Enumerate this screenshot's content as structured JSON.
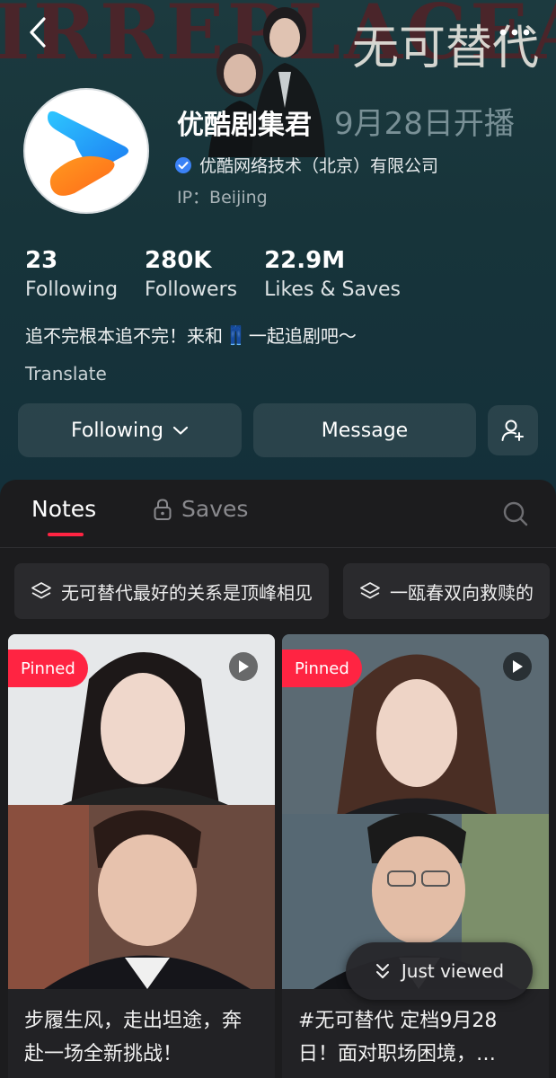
{
  "banner": {
    "watermark": "IRREPLACEABLE",
    "show_title": "无可替代",
    "premiere": "9月28日开播"
  },
  "nav": {
    "back_icon": "chevron-left-icon",
    "more_icon": "more-dots-icon"
  },
  "profile": {
    "name": "优酷剧集君",
    "verified_org": "优酷网络技术（北京）有限公司",
    "ip": "IP：Beijing",
    "bio_before": "追不完根本追不完！来和",
    "bio_emoji": "👖",
    "bio_after": "一起追剧吧～",
    "translate": "Translate"
  },
  "stats": [
    {
      "value": "23",
      "label": "Following"
    },
    {
      "value": "280K",
      "label": "Followers"
    },
    {
      "value": "22.9M",
      "label": "Likes & Saves"
    }
  ],
  "actions": {
    "following": "Following",
    "message": "Message"
  },
  "tabs": {
    "notes": "Notes",
    "saves": "Saves"
  },
  "collections": [
    {
      "label": "无可替代最好的关系是顶峰相见"
    },
    {
      "label": "一瓯春双向救赎的"
    }
  ],
  "cards": [
    {
      "badge": "Pinned",
      "title": "步履生风，走出坦途，奔赴一场全新挑战！"
    },
    {
      "badge": "Pinned",
      "title": "#无可替代 定档9月28日！面对职场困境，…"
    }
  ],
  "just_viewed": "Just viewed",
  "colors": {
    "accent": "#ff2442",
    "verified": "#3b82f6"
  }
}
